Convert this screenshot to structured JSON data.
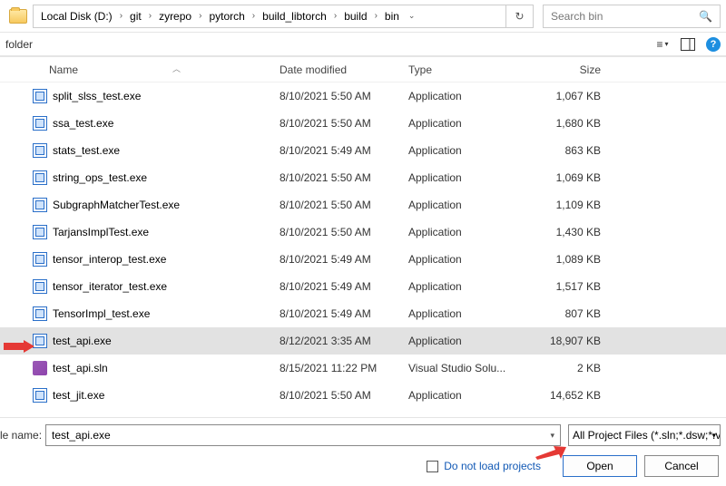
{
  "breadcrumbs": [
    "Local Disk (D:)",
    "git",
    "zyrepo",
    "pytorch",
    "build_libtorch",
    "build",
    "bin"
  ],
  "search": {
    "placeholder": "Search bin"
  },
  "folder_label": "folder",
  "columns": {
    "name": "Name",
    "date": "Date modified",
    "type": "Type",
    "size": "Size"
  },
  "files": [
    {
      "name": "split_slss_test.exe",
      "date": "8/10/2021 5:50 AM",
      "type": "Application",
      "size": "1,067 KB",
      "icon": "exe",
      "sel": false
    },
    {
      "name": "ssa_test.exe",
      "date": "8/10/2021 5:50 AM",
      "type": "Application",
      "size": "1,680 KB",
      "icon": "exe",
      "sel": false
    },
    {
      "name": "stats_test.exe",
      "date": "8/10/2021 5:49 AM",
      "type": "Application",
      "size": "863 KB",
      "icon": "exe",
      "sel": false
    },
    {
      "name": "string_ops_test.exe",
      "date": "8/10/2021 5:50 AM",
      "type": "Application",
      "size": "1,069 KB",
      "icon": "exe",
      "sel": false
    },
    {
      "name": "SubgraphMatcherTest.exe",
      "date": "8/10/2021 5:50 AM",
      "type": "Application",
      "size": "1,109 KB",
      "icon": "exe",
      "sel": false
    },
    {
      "name": "TarjansImplTest.exe",
      "date": "8/10/2021 5:50 AM",
      "type": "Application",
      "size": "1,430 KB",
      "icon": "exe",
      "sel": false
    },
    {
      "name": "tensor_interop_test.exe",
      "date": "8/10/2021 5:49 AM",
      "type": "Application",
      "size": "1,089 KB",
      "icon": "exe",
      "sel": false
    },
    {
      "name": "tensor_iterator_test.exe",
      "date": "8/10/2021 5:49 AM",
      "type": "Application",
      "size": "1,517 KB",
      "icon": "exe",
      "sel": false
    },
    {
      "name": "TensorImpl_test.exe",
      "date": "8/10/2021 5:49 AM",
      "type": "Application",
      "size": "807 KB",
      "icon": "exe",
      "sel": false
    },
    {
      "name": "test_api.exe",
      "date": "8/12/2021 3:35 AM",
      "type": "Application",
      "size": "18,907 KB",
      "icon": "exe",
      "sel": true
    },
    {
      "name": "test_api.sln",
      "date": "8/15/2021 11:22 PM",
      "type": "Visual Studio Solu...",
      "size": "2 KB",
      "icon": "sln",
      "sel": false
    },
    {
      "name": "test_jit.exe",
      "date": "8/10/2021 5:50 AM",
      "type": "Application",
      "size": "14,652 KB",
      "icon": "exe",
      "sel": false
    }
  ],
  "filename_label": "le name:",
  "filename_value": "test_api.exe",
  "filter_label": "All Project Files (*.sln;*.dsw;*.vc",
  "checkbox_label": "Do not load projects",
  "buttons": {
    "open": "Open",
    "cancel": "Cancel"
  }
}
